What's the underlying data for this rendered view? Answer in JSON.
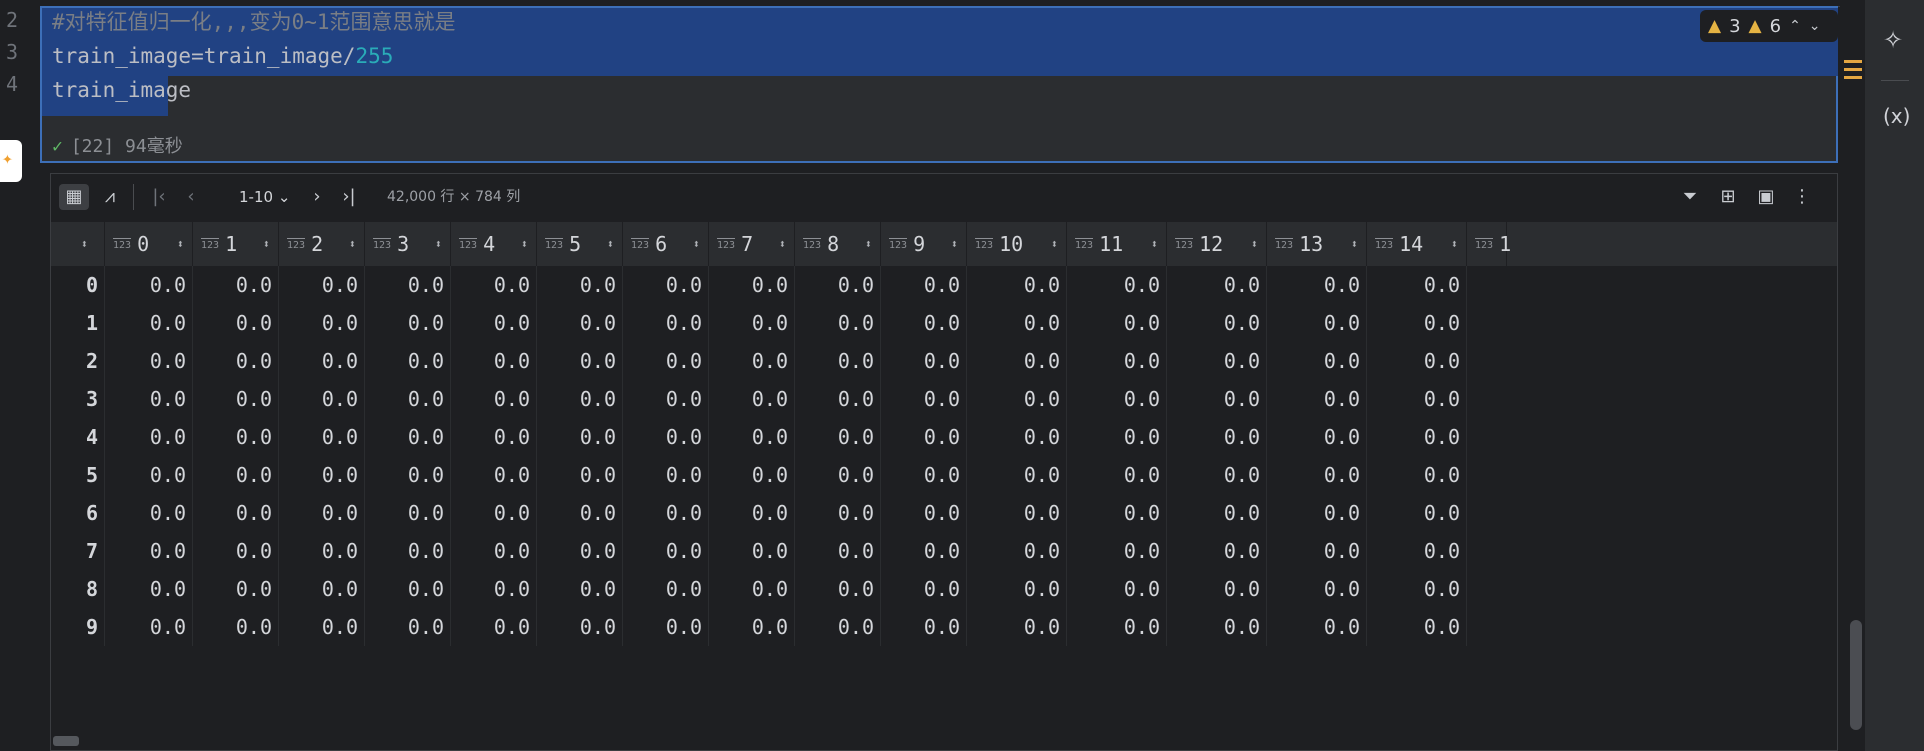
{
  "editor": {
    "line_numbers": [
      "2",
      "3",
      "4"
    ],
    "line1_comment": "#对特征值归一化,,,变为0~1范围意思就是",
    "line2_code": "train_image=train_image/",
    "line2_number": "255",
    "line3_code": "train_image",
    "exec_status": "[22] 94毫秒",
    "warnings_a": "3",
    "warnings_b": "6"
  },
  "icons": {
    "warning": "warning-icon",
    "check": "check-icon",
    "table_view": "table-view-icon",
    "chart_view": "chart-view-icon",
    "filter": "filter-icon",
    "column_settings": "column-settings-icon",
    "image_view": "image-view-icon",
    "more": "more-icon",
    "ai_assistant": "ai-assistant-icon",
    "variables": "variables-icon"
  },
  "toolbar": {
    "page_range": "1-10",
    "shape": "42,000 行 × 784 列"
  },
  "table": {
    "type_badge": "123",
    "columns": [
      "0",
      "1",
      "2",
      "3",
      "4",
      "5",
      "6",
      "7",
      "8",
      "9",
      "10",
      "11",
      "12",
      "13",
      "14",
      "1"
    ],
    "row_index": [
      "0",
      "1",
      "2",
      "3",
      "4",
      "5",
      "6",
      "7",
      "8",
      "9"
    ],
    "cell_value": "0.0"
  },
  "right_strip": {
    "variables_label": "(x)"
  },
  "colors": {
    "selection": "#214283",
    "accent": "#3d6fb8",
    "number": "#2aacb8",
    "success": "#5fb865",
    "warning": "#e5b343"
  }
}
